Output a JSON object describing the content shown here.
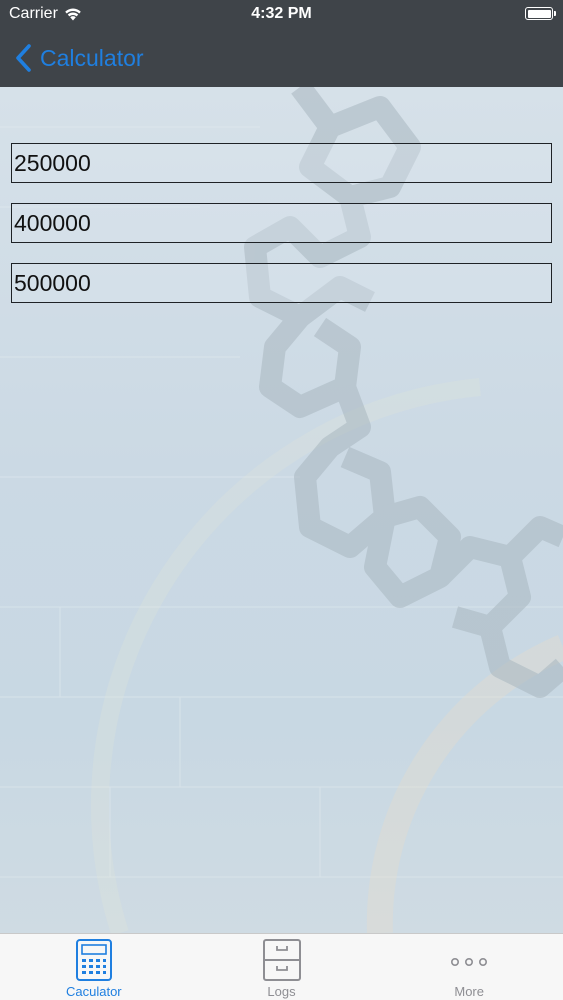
{
  "status_bar": {
    "carrier": "Carrier",
    "time": "4:32 PM",
    "battery_level_percent": 100
  },
  "nav_bar": {
    "back_label": "Calculator"
  },
  "fields": [
    {
      "value": "250000"
    },
    {
      "value": "400000"
    },
    {
      "value": "500000"
    }
  ],
  "tab_bar": {
    "tabs": [
      {
        "label": "Caculator",
        "icon": "calculator-icon",
        "active": true
      },
      {
        "label": "Logs",
        "icon": "cabinet-icon",
        "active": false
      },
      {
        "label": "More",
        "icon": "more-dots-icon",
        "active": false
      }
    ]
  },
  "colors": {
    "accent": "#1f7fe0",
    "topbar": "#3f4449",
    "tab_inactive": "#8e8e93"
  }
}
